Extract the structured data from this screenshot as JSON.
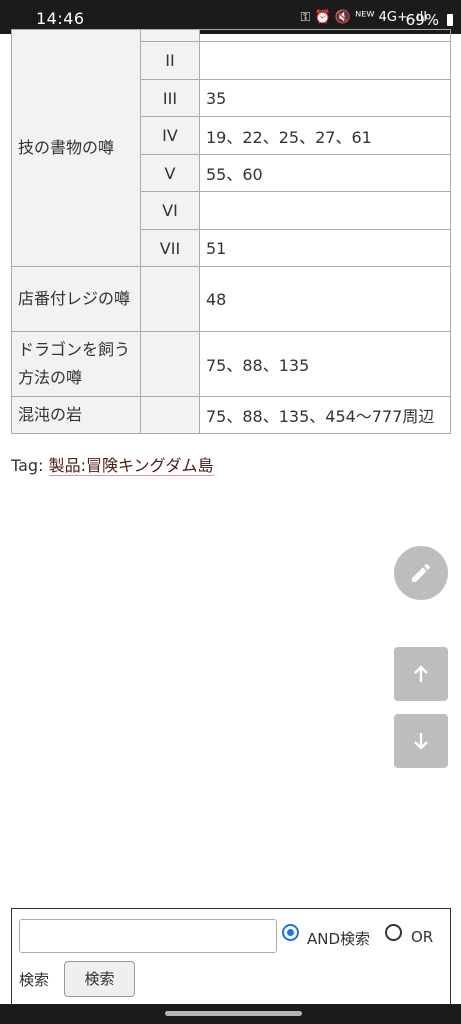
{
  "status_bar": {
    "time": "14:46",
    "icons_text": "⚿ ⏰ 🔇 ᴺᴱᵂ 4G+ .ıll",
    "battery": "69%"
  },
  "table": {
    "rows": [
      {
        "name": "",
        "num": "",
        "value": ""
      },
      {
        "name": "",
        "num": "II",
        "value": ""
      },
      {
        "name": "",
        "num": "III",
        "value": "35"
      },
      {
        "name": "技の書物の噂",
        "num": "IV",
        "value": "19、22、25、27、61"
      },
      {
        "name": "",
        "num": "V",
        "value": "55、60"
      },
      {
        "name": "",
        "num": "VI",
        "value": ""
      },
      {
        "name": "",
        "num": "VII",
        "value": "51"
      },
      {
        "name": "店番付レジの噂",
        "num": "",
        "value": "48"
      },
      {
        "name": "ドラゴンを飼う方法の噂",
        "num": "",
        "value": "75、88、135"
      },
      {
        "name": "混沌の岩",
        "num": "",
        "value": "75、88、135、454〜777周辺"
      }
    ]
  },
  "tag": {
    "label": "Tag:",
    "link": "製品:冒険キングダム島"
  },
  "search": {
    "input_value": "",
    "and_label": "AND検索",
    "or_label": "OR",
    "second_line_label": "検索",
    "button_label": "検索"
  },
  "icons": {
    "edit": "edit-icon",
    "up": "arrow-up-icon",
    "down": "arrow-down-icon"
  }
}
